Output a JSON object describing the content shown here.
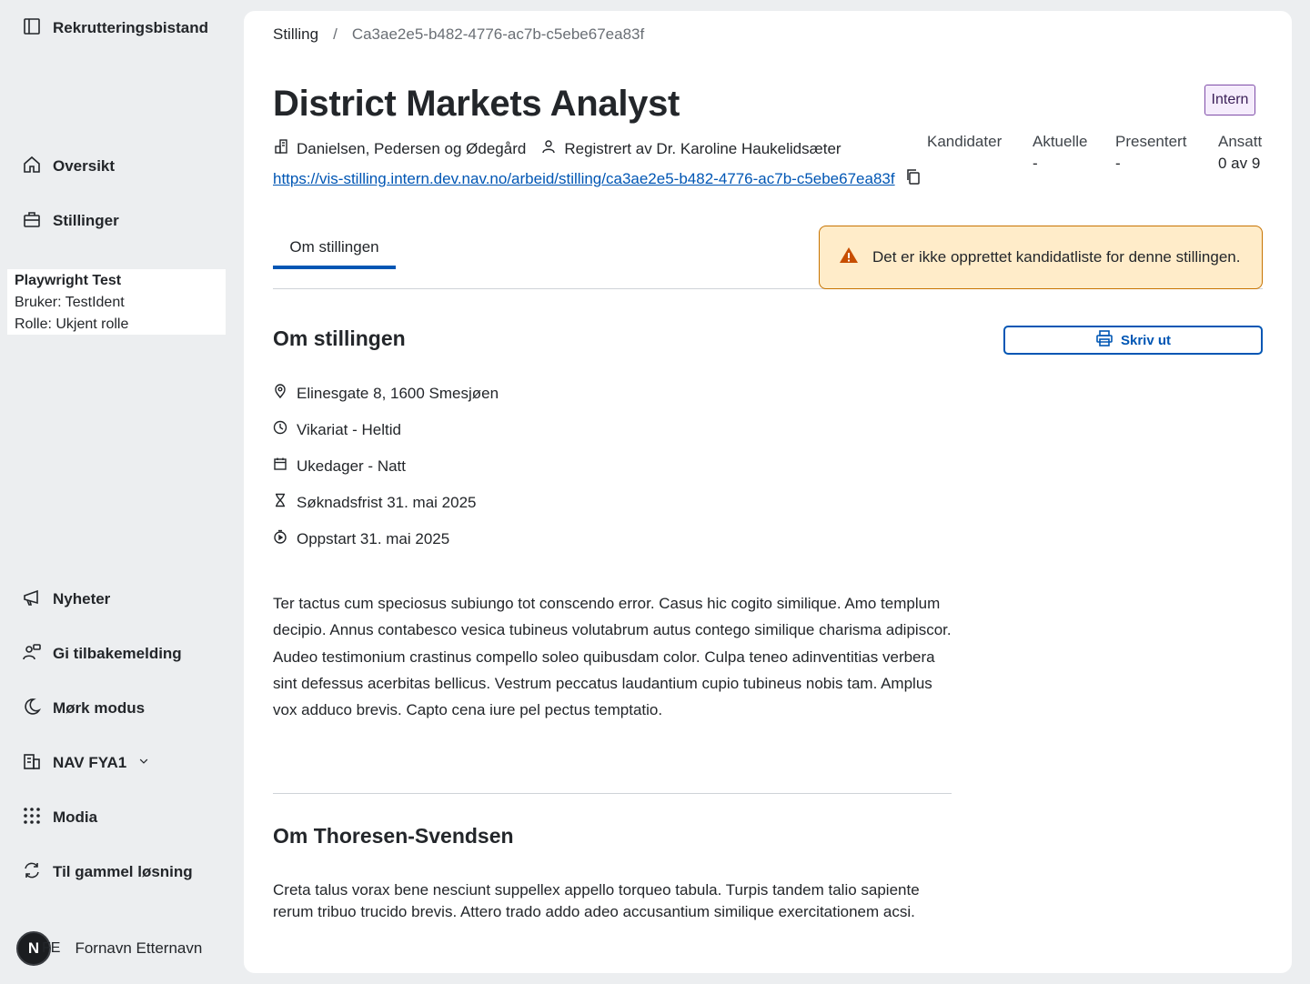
{
  "sidebar": {
    "app_title": "Rekrutteringsbistand",
    "nav": [
      {
        "label": "Oversikt",
        "icon": "house-icon"
      },
      {
        "label": "Stillinger",
        "icon": "briefcase-icon"
      }
    ],
    "info": {
      "name": "Playwright Test",
      "user": "Bruker: TestIdent",
      "role": "Rolle: Ukjent rolle"
    },
    "bottom": [
      {
        "label": "Nyheter",
        "icon": "megaphone-icon"
      },
      {
        "label": "Gi tilbakemelding",
        "icon": "people-feedback-icon"
      },
      {
        "label": "Mørk modus",
        "icon": "moon-icon"
      },
      {
        "label": "NAV FYA1",
        "icon": "buildings-icon"
      },
      {
        "label": "Modia",
        "icon": "grid-dots-icon"
      },
      {
        "label": "Til gammel løsning",
        "icon": "arrows-circle-icon"
      }
    ],
    "user": {
      "avatar_letter": "N",
      "initials": "FE",
      "name": "Fornavn Etternavn"
    }
  },
  "breadcrumb": {
    "root": "Stilling",
    "separator": "/",
    "current": "Ca3ae2e5-b482-4776-ac7b-c5ebe67ea83f"
  },
  "job": {
    "title": "District Markets Analyst",
    "badge": "Intern",
    "employer": "Danielsen, Pedersen og Ødegård",
    "registered_by": "Registrert av Dr. Karoline Haukelidsæter",
    "url": "https://vis-stilling.intern.dev.nav.no/arbeid/stilling/ca3ae2e5-b482-4776-ac7b-c5ebe67ea83f"
  },
  "stats": [
    {
      "label": "Kandidater",
      "value": ""
    },
    {
      "label": "Aktuelle",
      "value": "-"
    },
    {
      "label": "Presentert",
      "value": "-"
    },
    {
      "label": "Ansatt",
      "value": "0 av 9"
    }
  ],
  "tabs": {
    "active": "Om stillingen"
  },
  "alert": {
    "text": "Det er ikke opprettet kandidatliste for denne stillingen."
  },
  "about": {
    "heading": "Om stillingen",
    "print_label": "Skriv ut",
    "facts": [
      {
        "icon": "location-pin-icon",
        "text": "Elinesgate 8, 1600 Smesjøen"
      },
      {
        "icon": "clock-icon",
        "text": "Vikariat - Heltid"
      },
      {
        "icon": "calendar-icon",
        "text": "Ukedager - Natt"
      },
      {
        "icon": "hourglass-icon",
        "text": "Søknadsfrist 31. mai 2025"
      },
      {
        "icon": "stopwatch-icon",
        "text": "Oppstart 31. mai 2025"
      }
    ],
    "description": "Ter tactus cum speciosus subiungo tot conscendo error. Casus hic cogito similique. Amo templum decipio. Annus contabesco vesica tubineus volutabrum autus contego similique charisma adipiscor. Audeo testimonium crastinus compello soleo quibusdam color. Culpa teneo adinventitias verbera sint defessus acerbitas bellicus. Vestrum peccatus laudantium cupio tubineus nobis tam. Amplus vox adduco brevis. Capto cena iure pel pectus temptatio."
  },
  "employer_section": {
    "heading": "Om Thoresen-Svendsen",
    "text": "Creta talus vorax bene nesciunt suppellex appello torqueo tabula. Turpis tandem talio sapiente rerum tribuo trucido brevis. Attero trado addo adeo accusantium similique exercitationem acsi."
  },
  "colors": {
    "accent": "#0056b4",
    "warning_bg": "#ffecc9",
    "warning_border": "#c77300",
    "badge_bg": "#f5ecfc"
  }
}
